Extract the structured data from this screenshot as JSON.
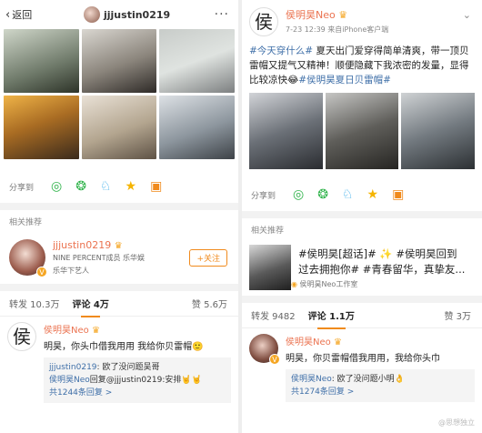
{
  "left": {
    "header": {
      "back_label": "返回",
      "username": "jjjustin0219",
      "more": "···"
    },
    "share": {
      "label": "分享到"
    },
    "related": {
      "title": "相关推荐",
      "account": {
        "name": "jjjustin0219",
        "desc": "NINE PERCENT成员 乐华娱",
        "sub": "乐华下艺人",
        "follow_label": "+关注"
      }
    },
    "tabs": {
      "repost": "转发 10.3万",
      "comment": "评论 4万",
      "like": "赞 5.6万"
    },
    "comment": {
      "avatar_char": "侯",
      "name": "侯明昊Neo",
      "text": "明昊，你头巾借我用用 我给你贝雷帽🙂",
      "replies": [
        {
          "name": "jjjustin0219",
          "text": ": 欧了没问题吴哥"
        },
        {
          "name": "侯明昊Neo",
          "text": "回复@jjjustin0219:安排🤘🤘"
        }
      ],
      "more": "共1244条回复 >"
    }
  },
  "right": {
    "post": {
      "avatar_char": "侯",
      "name": "侯明昊Neo",
      "meta": "7-23 12:39  来自iPhone客户端",
      "tag1": "#今天穿什么#",
      "body": " 夏天出门爱穿得简单清爽，带一顶贝雷帽又提气又精神！顺便隐藏下我浓密的发量，显得比较凉快",
      "emoji": "😂",
      "tag2": "#侯明昊夏日贝雷帽#"
    },
    "share": {
      "label": "分享到"
    },
    "related": {
      "title": "相关推荐",
      "text_line1": "#侯明昊[超话]# ✨ #侯明昊回到",
      "text_line2": "过去拥抱你# #青春留华，真挚友...",
      "sub": "侯明昊Neo工作室"
    },
    "tabs": {
      "repost": "转发 9482",
      "comment": "评论 1.1万",
      "like": "赞 3万"
    },
    "comment": {
      "name": "侯明昊Neo",
      "text": "明昊，你贝雷帽借我用用，我给你头巾",
      "reply_name": "侯明昊Neo",
      "reply_text": ": 欧了没问题小明👌",
      "more": "共1274条回复 >"
    },
    "watermark": "@思想独立"
  }
}
